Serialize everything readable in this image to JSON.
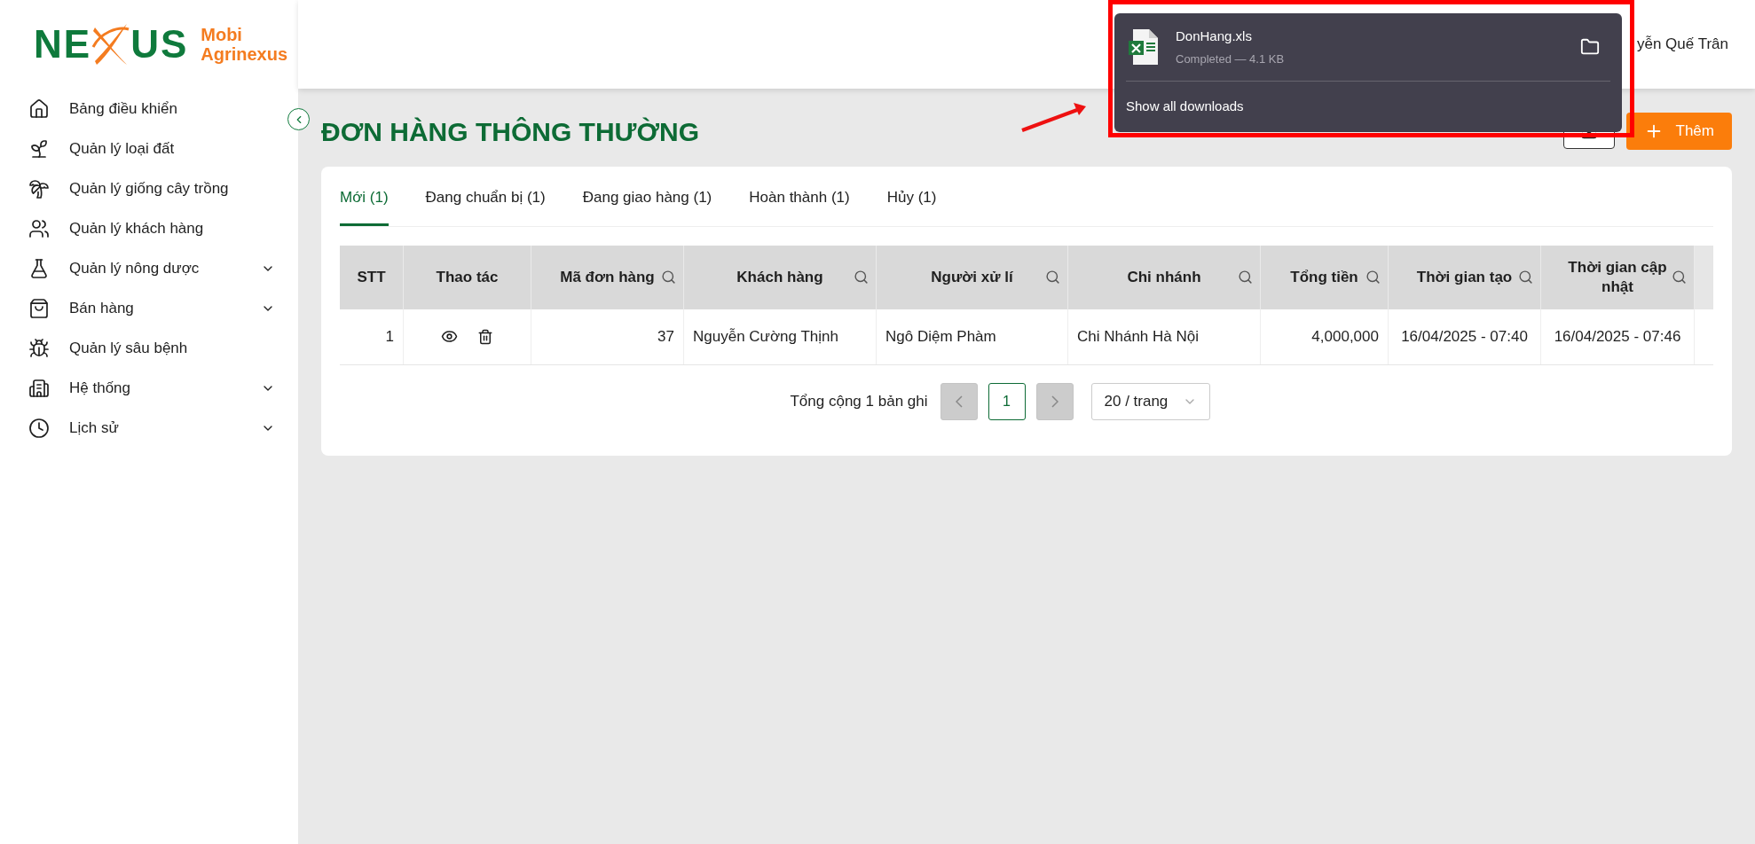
{
  "logo": {
    "mark_left": "NE",
    "mark_right": "US",
    "line_1": "Mobi",
    "line_2": "Agrinexus"
  },
  "header": {
    "user_name": "yễn Quế Trân"
  },
  "sidebar": {
    "items": [
      {
        "label": "Bảng điều khiển",
        "has_submenu": false
      },
      {
        "label": "Quản lý loại đất",
        "has_submenu": false
      },
      {
        "label": "Quản lý giống cây trồng",
        "has_submenu": false
      },
      {
        "label": "Quản lý khách hàng",
        "has_submenu": false
      },
      {
        "label": "Quản lý nông dược",
        "has_submenu": true
      },
      {
        "label": "Bán hàng",
        "has_submenu": true
      },
      {
        "label": "Quản lý sâu bệnh",
        "has_submenu": false
      },
      {
        "label": "Hệ thống",
        "has_submenu": true
      },
      {
        "label": "Lịch sử",
        "has_submenu": true
      }
    ]
  },
  "page": {
    "title": "ĐƠN HÀNG THÔNG THƯỜNG",
    "add_button": "Thêm"
  },
  "tabs": [
    {
      "label": "Mới (1)",
      "selected": true
    },
    {
      "label": "Đang chuẩn bị (1)",
      "selected": false
    },
    {
      "label": "Đang giao hàng (1)",
      "selected": false
    },
    {
      "label": "Hoàn thành (1)",
      "selected": false
    },
    {
      "label": "Hủy (1)",
      "selected": false
    }
  ],
  "table": {
    "columns": [
      {
        "label": "STT",
        "searchable": false
      },
      {
        "label": "Thao tác",
        "searchable": false
      },
      {
        "label": "Mã đơn hàng",
        "searchable": true
      },
      {
        "label": "Khách hàng",
        "searchable": true
      },
      {
        "label": "Người xử lí",
        "searchable": true
      },
      {
        "label": "Chi nhánh",
        "searchable": true
      },
      {
        "label": "Tổng tiền",
        "searchable": true
      },
      {
        "label": "Thời gian tạo",
        "searchable": true
      },
      {
        "label": "Thời gian cập nhật",
        "searchable": true
      }
    ],
    "rows": [
      {
        "stt": "1",
        "order_id": "37",
        "customer": "Nguyễn Cường Thịnh",
        "handler": "Ngô Diệm Phàm",
        "branch": "Chi Nhánh Hà Nội",
        "total": "4,000,000",
        "created": "16/04/2025 - 07:40",
        "updated": "16/04/2025 - 07:46"
      }
    ]
  },
  "pagination": {
    "summary": "Tổng cộng 1 bản ghi",
    "prev_disabled": true,
    "pages": [
      {
        "label": "1",
        "selected": true
      }
    ],
    "next_disabled": true,
    "page_size": "20 / trang"
  },
  "download_popup": {
    "file_name": "DonHang.xls",
    "status": "Completed — 4.1 KB",
    "link": "Show all downloads"
  }
}
